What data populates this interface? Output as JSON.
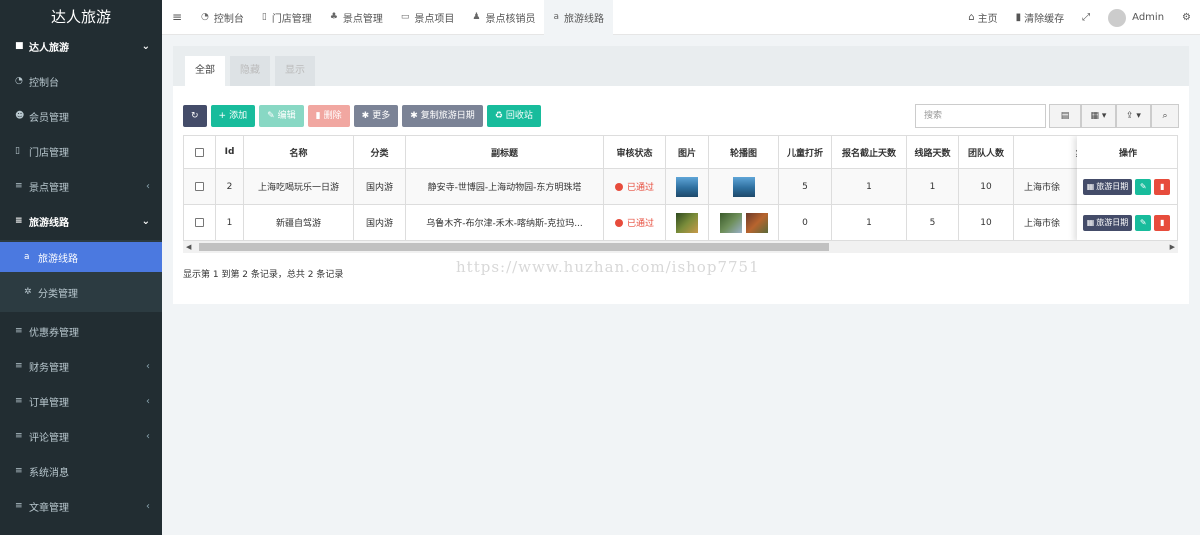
{
  "sidebar": {
    "brand": "达人旅游",
    "top_menu": {
      "label": "达人旅游",
      "icon": "folder-icon"
    },
    "items": [
      {
        "label": "控制台",
        "icon": "dashboard-icon"
      },
      {
        "label": "会员管理",
        "icon": "users-icon"
      },
      {
        "label": "门店管理",
        "icon": "building-icon"
      },
      {
        "label": "景点管理",
        "icon": "list-icon"
      },
      {
        "label": "旅游线路",
        "icon": "list-icon"
      },
      {
        "label": "旅游线路",
        "icon": "amazon-icon"
      },
      {
        "label": "分类管理",
        "icon": "gears-icon"
      },
      {
        "label": "优惠券管理",
        "icon": "list-icon"
      },
      {
        "label": "财务管理",
        "icon": "list-icon"
      },
      {
        "label": "订单管理",
        "icon": "list-icon"
      },
      {
        "label": "评论管理",
        "icon": "list-icon"
      },
      {
        "label": "系统消息",
        "icon": "list-icon"
      },
      {
        "label": "文章管理",
        "icon": "list-icon"
      }
    ]
  },
  "topbar": {
    "tabs": [
      {
        "label": "控制台",
        "icon": "dashboard-icon"
      },
      {
        "label": "门店管理",
        "icon": "building-icon"
      },
      {
        "label": "景点管理",
        "icon": "tree-icon"
      },
      {
        "label": "景点项目",
        "icon": "keyboard-icon"
      },
      {
        "label": "景点核销员",
        "icon": "user-icon"
      },
      {
        "label": "旅游线路",
        "icon": "amazon-icon"
      }
    ],
    "home": "主页",
    "clear_cache": "清除缓存",
    "user": "Admin"
  },
  "panel_tabs": [
    "全部",
    "隐藏",
    "显示"
  ],
  "toolbar": {
    "add": "添加",
    "edit": "编辑",
    "delete": "删除",
    "more": "更多",
    "copy_dates": "复制旅游日期",
    "recycle": "回收站"
  },
  "search": {
    "placeholder": "搜索"
  },
  "table": {
    "columns": [
      "Id",
      "名称",
      "分类",
      "副标题",
      "审核状态",
      "图片",
      "轮播图",
      "儿童打折",
      "报名截止天数",
      "线路天数",
      "团队人数",
      "集"
    ],
    "op_header": "操作",
    "rows": [
      {
        "id": "2",
        "name": "上海吃喝玩乐一日游",
        "category": "国内游",
        "subtitle": "静安寺-世博园-上海动物园-东方明珠塔",
        "status": "已通过",
        "child_discount": "5",
        "deadline_days": "1",
        "days": "1",
        "team_size": "10",
        "meet": "上海市徐"
      },
      {
        "id": "1",
        "name": "新疆自驾游",
        "category": "国内游",
        "subtitle": "乌鲁木齐-布尔津-禾木-喀纳斯-克拉玛...",
        "status": "已通过",
        "child_discount": "0",
        "deadline_days": "1",
        "days": "5",
        "team_size": "10",
        "meet": "上海市徐"
      }
    ],
    "op_button": "旅游日期"
  },
  "footer": "显示第 1 到第 2 条记录，总共 2 条记录",
  "watermark": "https://www.huzhan.com/ishop7751"
}
